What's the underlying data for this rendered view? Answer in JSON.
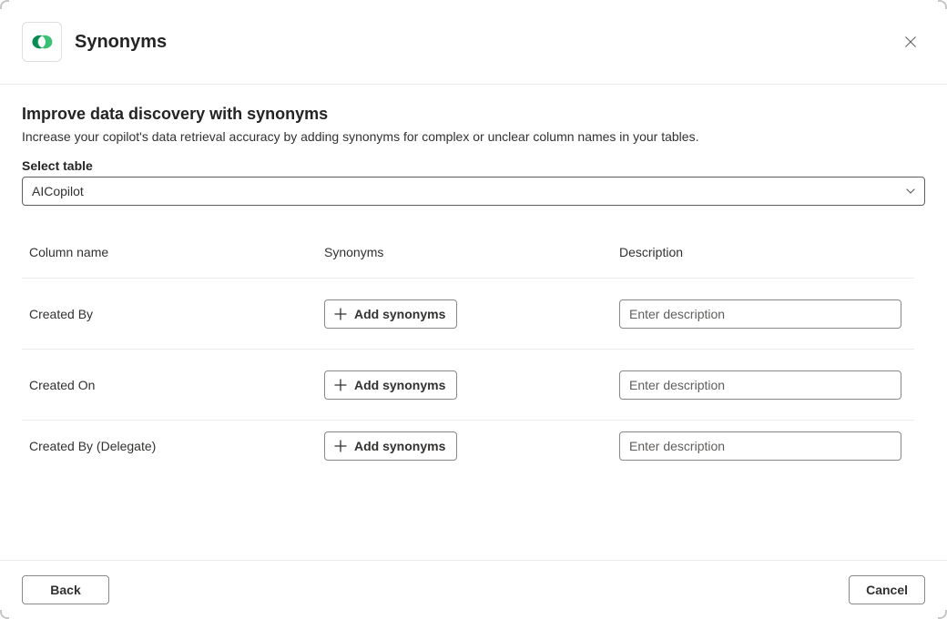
{
  "header": {
    "title": "Synonyms",
    "icon": "dataverse-logo",
    "close_label": "Close"
  },
  "main": {
    "heading": "Improve data discovery with synonyms",
    "subheading": "Increase your copilot's data retrieval accuracy by adding synonyms for complex or unclear column names in your tables.",
    "select_label": "Select table",
    "select_value": "AICopilot"
  },
  "table": {
    "columns": {
      "name": "Column name",
      "synonyms": "Synonyms",
      "description": "Description"
    },
    "add_synonyms_label": "Add synonyms",
    "description_placeholder": "Enter description",
    "rows": [
      {
        "name": "Created By",
        "description": ""
      },
      {
        "name": "Created On",
        "description": ""
      },
      {
        "name": "Created By (Delegate)",
        "description": ""
      }
    ]
  },
  "footer": {
    "back": "Back",
    "cancel": "Cancel"
  }
}
